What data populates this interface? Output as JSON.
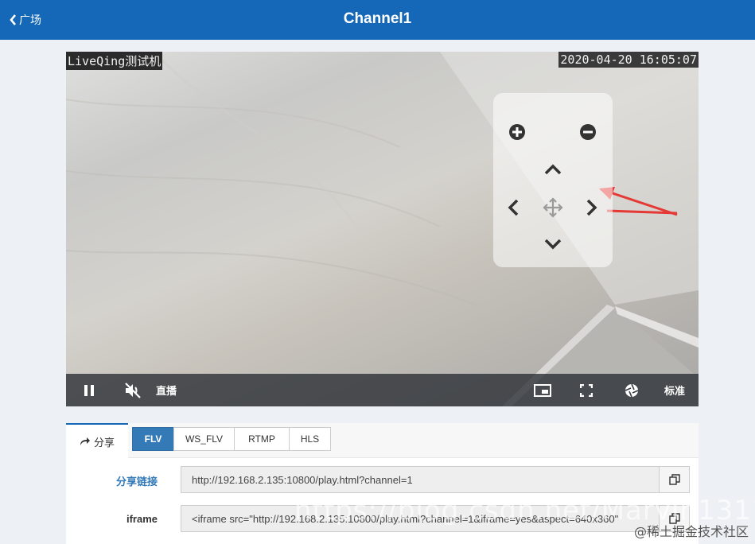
{
  "header": {
    "back_label": "广场",
    "title": "Channel1"
  },
  "video": {
    "osd_left": "LiveQing测试机",
    "osd_right": "2020-04-20 16:05:07",
    "ptz": {
      "zoom_in": "plus-circle-icon",
      "zoom_out": "minus-circle-icon",
      "up": "chevron-up-icon",
      "down": "chevron-down-icon",
      "left": "chevron-left-icon",
      "right": "chevron-right-icon",
      "center": "move-icon"
    },
    "controls": {
      "live_label": "直播",
      "quality_label": "标准"
    }
  },
  "share": {
    "tab_label": "分享",
    "formats": [
      "FLV",
      "WS_FLV",
      "RTMP",
      "HLS"
    ],
    "active_format": "FLV",
    "link_label": "分享链接",
    "link_value": "http://192.168.2.135:10800/play.html?channel=1",
    "iframe_label": "iframe",
    "iframe_value": "<iframe src=\"http://192.168.2.135:10800/play.html?channel=1&iframe=yes&aspect=640x360\""
  },
  "watermarks": {
    "overlay": "https://blog.csdn.net/Marvin1311",
    "site": "@稀土掘金技术社区"
  },
  "colors": {
    "header_bg": "#1567b8",
    "active_tab": "#337ab7",
    "link_label": "#337ab7",
    "annotation_arrow": "#e53935"
  }
}
